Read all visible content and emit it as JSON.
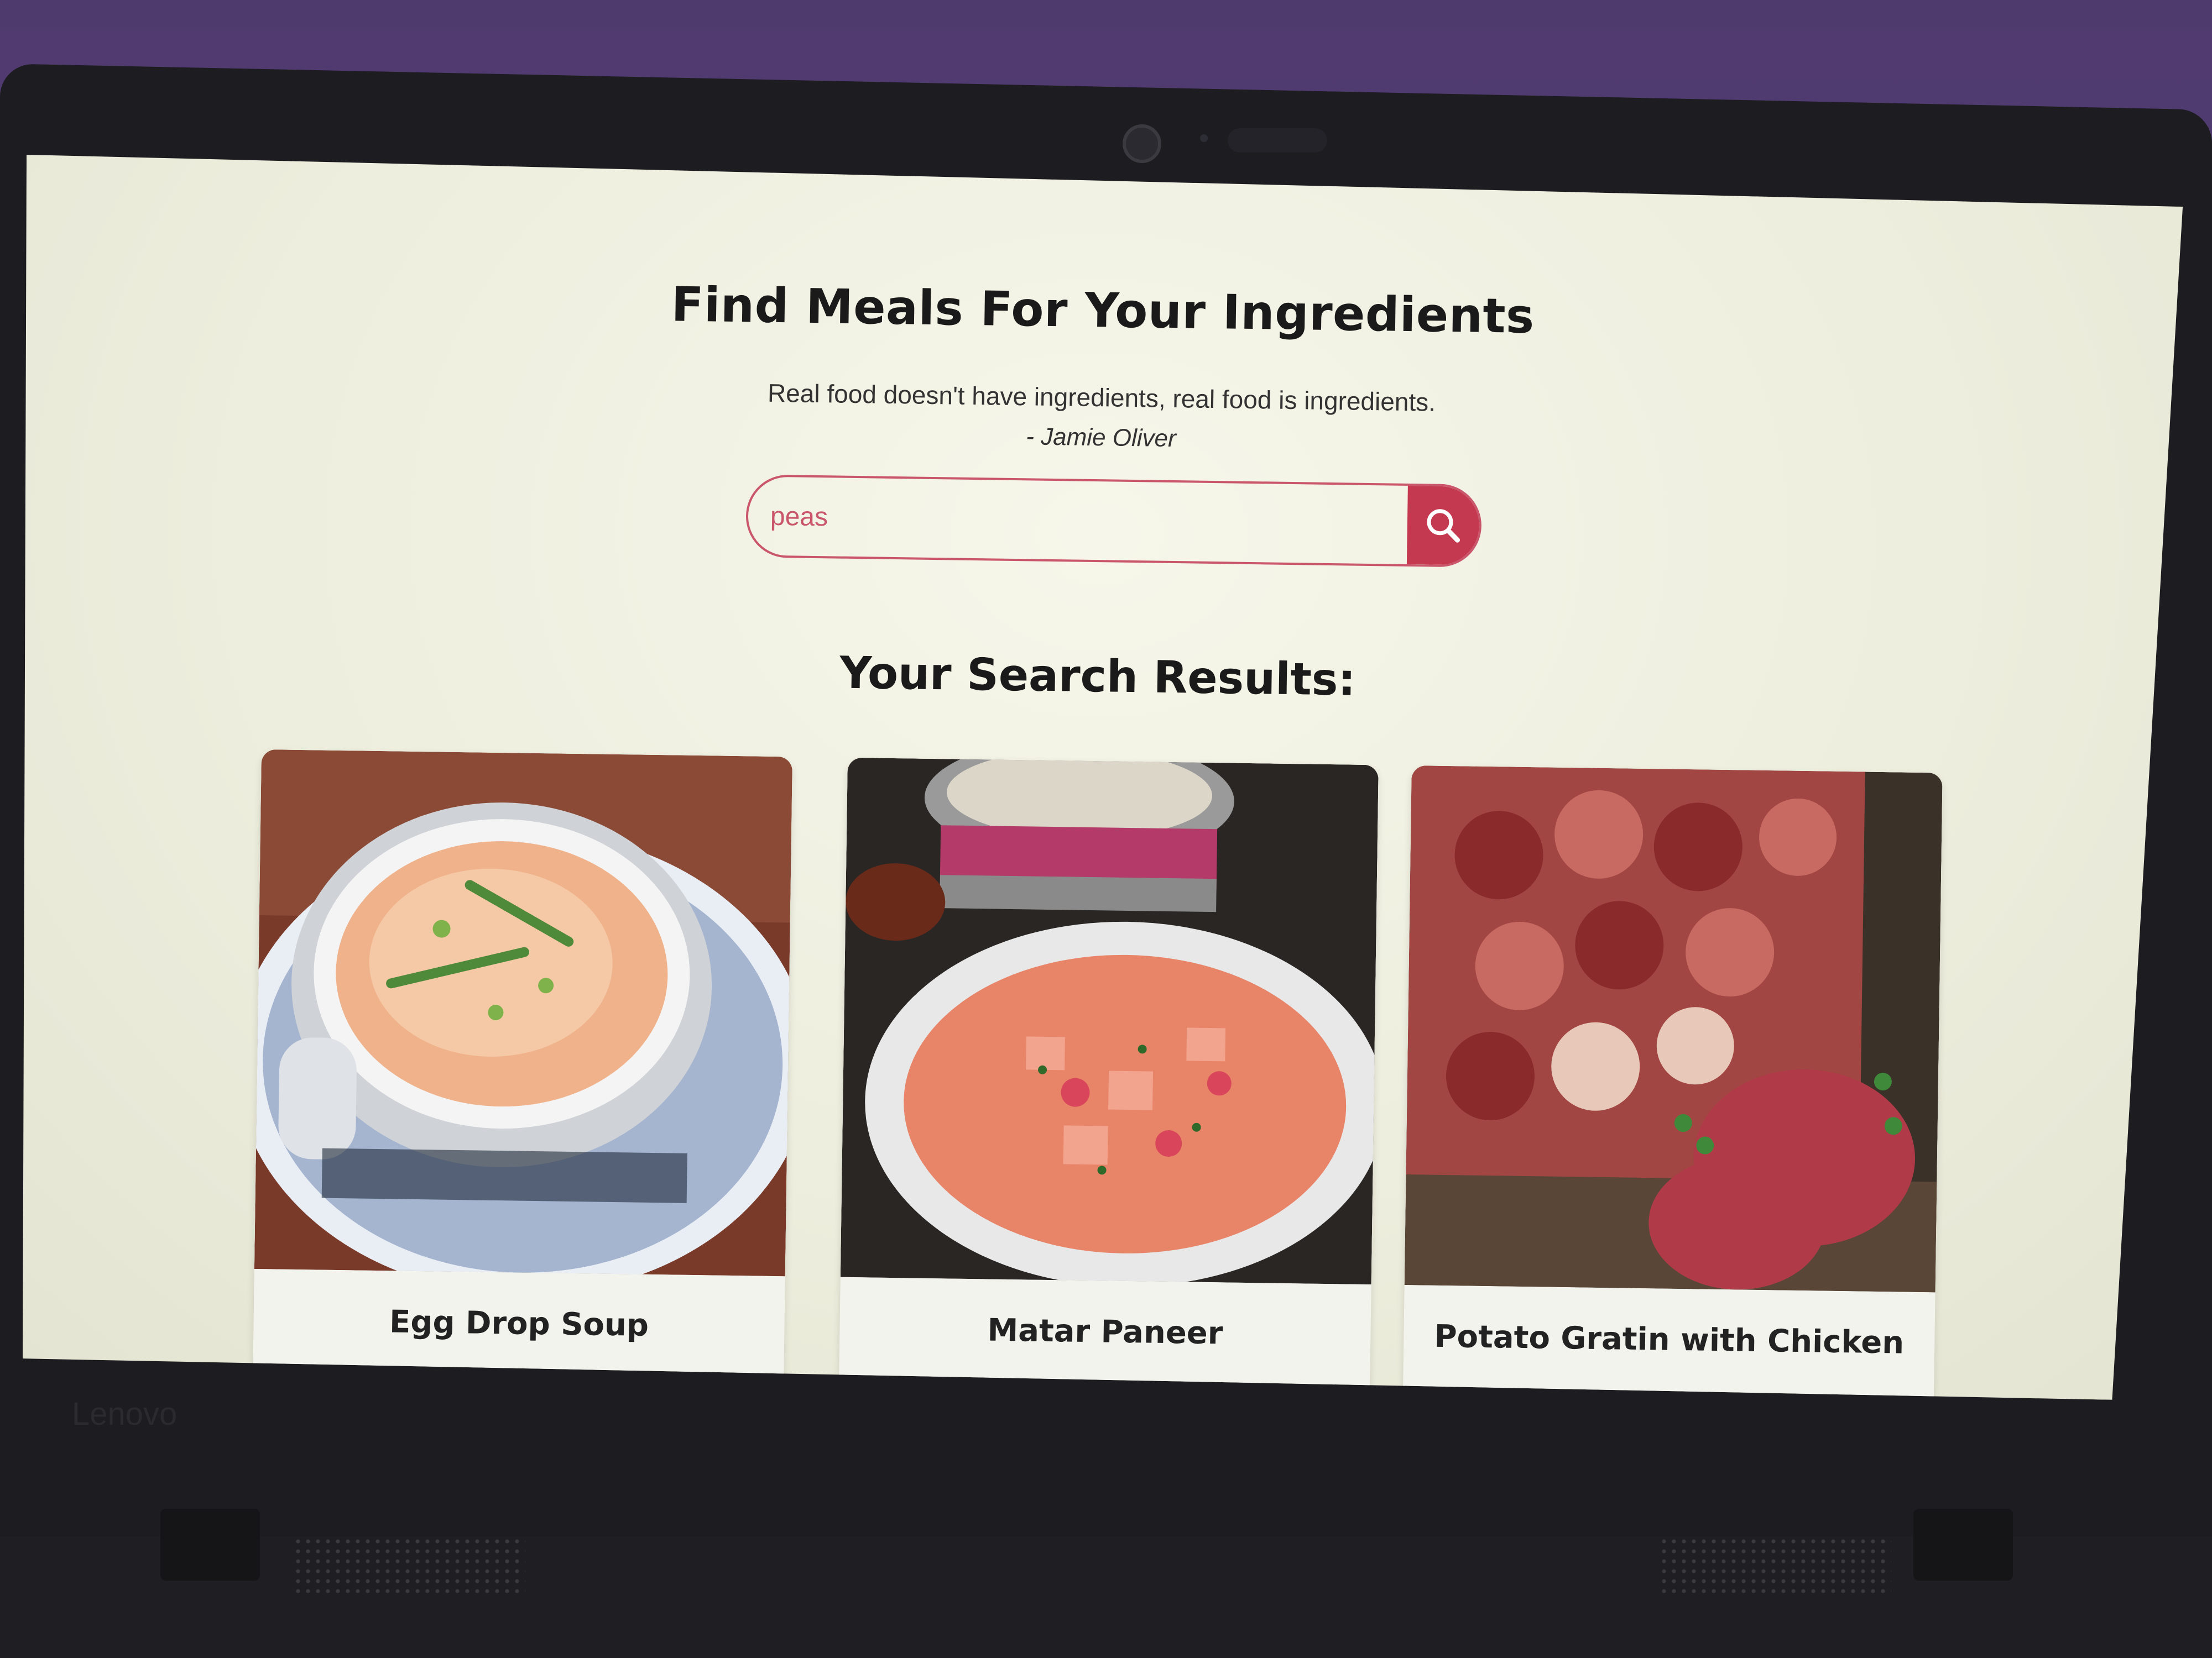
{
  "page": {
    "title": "Find Meals For Your Ingredients",
    "quote": "Real food doesn't have ingredients, real food is ingredients.",
    "quote_author": "- Jamie Oliver"
  },
  "search": {
    "value": "peas",
    "button_icon": "search-icon"
  },
  "results": {
    "heading": "Your Search Results:",
    "meals": [
      {
        "name": "Egg Drop Soup"
      },
      {
        "name": "Matar Paneer"
      },
      {
        "name": "Potato Gratin with Chicken"
      }
    ]
  },
  "device": {
    "brand": "Lenovo"
  },
  "colors": {
    "accent": "#c43950",
    "background": "#f2f2e6",
    "heading": "#1a1a1a"
  }
}
